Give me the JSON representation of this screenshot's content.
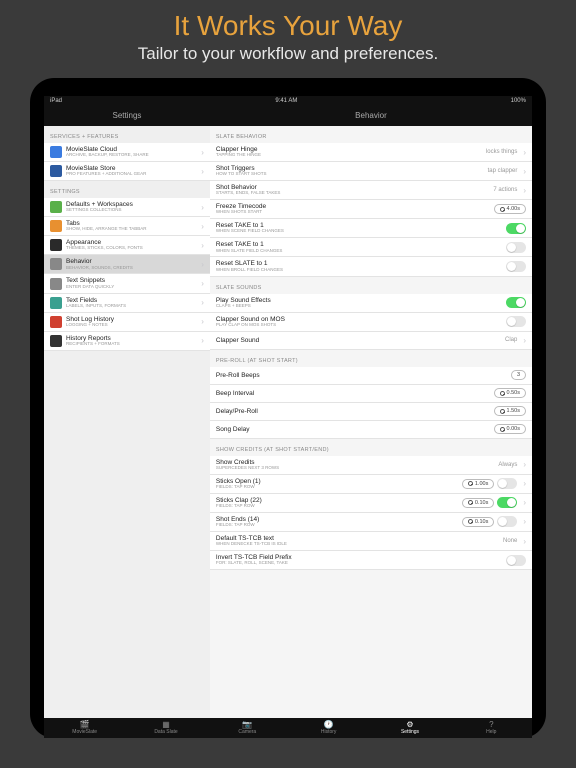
{
  "promo": {
    "title": "It Works Your Way",
    "subtitle": "Tailor to your workflow and preferences."
  },
  "status": {
    "device": "iPad",
    "wifi": "⋯",
    "time": "9:41 AM",
    "battery": "100%"
  },
  "nav": {
    "left": "Settings",
    "right": "Behavior"
  },
  "sidebar": {
    "sections": [
      {
        "header": "SERVICES + FEATURES",
        "items": [
          {
            "icon": "ic-blue",
            "title": "MovieSlate Cloud",
            "sub": "ARCHIVE, BACKUP, RESTORE, SHARE"
          },
          {
            "icon": "ic-blue2",
            "title": "MovieSlate Store",
            "sub": "PRO FEATURES + ADDITIONAL GEAR"
          }
        ]
      },
      {
        "header": "SETTINGS",
        "items": [
          {
            "icon": "ic-green",
            "title": "Defaults + Workspaces",
            "sub": "SETTINGS COLLECTIONS"
          },
          {
            "icon": "ic-orange",
            "title": "Tabs",
            "sub": "SHOW, HIDE, ARRANGE THE TABBAR"
          },
          {
            "icon": "ic-dark",
            "title": "Appearance",
            "sub": "THEMES, STICKS, COLORS, FONTS"
          },
          {
            "icon": "ic-gray",
            "title": "Behavior",
            "sub": "BEHAVIOR, SOUNDS, CREDITS",
            "selected": true
          },
          {
            "icon": "ic-gray",
            "title": "Text Snippets",
            "sub": "ENTER DATA QUICKLY"
          },
          {
            "icon": "ic-teal",
            "title": "Text Fields",
            "sub": "LABELS, INPUTS, FORMATS"
          },
          {
            "icon": "ic-red",
            "title": "Shot Log History",
            "sub": "LOGGING + NOTES"
          },
          {
            "icon": "ic-dark2",
            "title": "History Reports",
            "sub": "RECIPIENTS + FORMATS"
          }
        ]
      }
    ]
  },
  "main": {
    "sections": [
      {
        "header": "SLATE BEHAVIOR",
        "rows": [
          {
            "title": "Clapper Hinge",
            "sub": "TAPPING THE HINGE",
            "value": "locks things",
            "chev": true
          },
          {
            "title": "Shot Triggers",
            "sub": "HOW TO START SHOTS",
            "value": "tap clapper",
            "chev": true
          },
          {
            "title": "Shot Behavior",
            "sub": "STARTS, ENDS, FALSE TAKES",
            "value": "7 actions",
            "chev": true
          },
          {
            "title": "Freeze Timecode",
            "sub": "WHEN SHOTS START",
            "pill": "4.00s",
            "clock": true
          },
          {
            "title": "Reset TAKE to 1",
            "sub": "WHEN SCENE FIELD CHANGES",
            "toggle": "on"
          },
          {
            "title": "Reset TAKE to 1",
            "sub": "WHEN SLATE FIELD CHANGES",
            "toggle": "off"
          },
          {
            "title": "Reset SLATE to 1",
            "sub": "WHEN BROLL FIELD CHANGES",
            "toggle": "off"
          }
        ]
      },
      {
        "header": "SLATE SOUNDS",
        "rows": [
          {
            "title": "Play Sound Effects",
            "sub": "CLAPS + BEEPS",
            "toggle": "on"
          },
          {
            "title": "Clapper Sound on MOS",
            "sub": "PLAY CLAP ON MOS SHOTS",
            "toggle": "off"
          },
          {
            "title": "Clapper Sound",
            "sub": "",
            "value": "Clap",
            "chev": true
          }
        ]
      },
      {
        "header": "PRE-ROLL (AT SHOT START)",
        "rows": [
          {
            "title": "Pre-Roll Beeps",
            "sub": "",
            "pill": "3"
          },
          {
            "title": "Beep Interval",
            "sub": "",
            "pill": "0.50s",
            "clock": true
          },
          {
            "title": "Delay/Pre-Roll",
            "sub": "",
            "pill": "1.50s",
            "clock": true
          },
          {
            "title": "Song Delay",
            "sub": "",
            "pill": "0.00s",
            "clock": true
          }
        ]
      },
      {
        "header": "SHOW CREDITS (AT SHOT START/END)",
        "rows": [
          {
            "title": "Show Credits",
            "sub": "SUPERCEDES NEXT 3 ROWS",
            "value": "Always",
            "chev": true
          },
          {
            "title": "Sticks Open (1)",
            "sub": "FIELDS: TAP ROW",
            "pill": "1.00s",
            "clock": true,
            "toggle": "off",
            "chev": true
          },
          {
            "title": "Sticks Clap (22)",
            "sub": "FIELDS: TAP ROW",
            "pill": "0.10s",
            "clock": true,
            "toggle": "on",
            "chev": true
          },
          {
            "title": "Shot Ends (14)",
            "sub": "FIELDS: TAP ROW",
            "pill": "0.10s",
            "clock": true,
            "toggle": "off",
            "chev": true
          },
          {
            "title": "Default TS-TCB text",
            "sub": "WHEN DENECKE TS-TCB IS IDLE",
            "value": "None",
            "chev": true
          },
          {
            "title": "Invert TS-TCB Field Prefix",
            "sub": "FOR: SLATE, ROLL, SCENE, TAKE",
            "toggle": "off"
          }
        ]
      }
    ]
  },
  "tabs": [
    {
      "label": "MovieSlate",
      "icon": "🎬"
    },
    {
      "label": "Data Slate",
      "icon": "▦"
    },
    {
      "label": "Camera",
      "icon": "📷"
    },
    {
      "label": "History",
      "icon": "🕐"
    },
    {
      "label": "Settings",
      "icon": "⚙",
      "active": true
    },
    {
      "label": "Help",
      "icon": "?"
    }
  ]
}
